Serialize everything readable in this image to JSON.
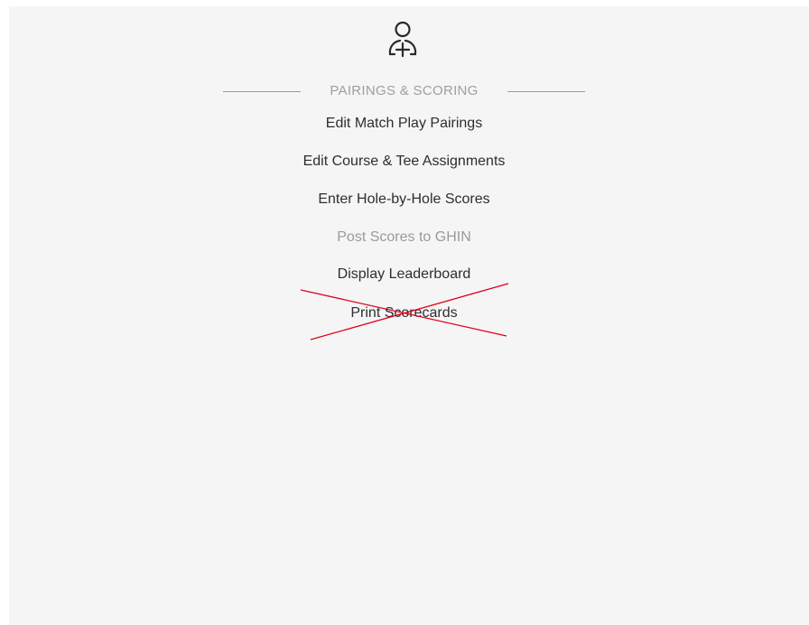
{
  "icon": "add-user-icon",
  "section": {
    "title": "PAIRINGS & SCORING"
  },
  "menu": {
    "items": [
      {
        "label": "Edit Match Play Pairings",
        "enabled": true
      },
      {
        "label": "Edit Course & Tee Assignments",
        "enabled": true
      },
      {
        "label": "Enter Hole-by-Hole Scores",
        "enabled": true
      },
      {
        "label": "Post Scores to GHIN",
        "enabled": false
      },
      {
        "label": "Display Leaderboard",
        "enabled": true
      },
      {
        "label": "Print Scorecards",
        "enabled": true,
        "crossed_out": true
      }
    ]
  },
  "colors": {
    "panel_background": "#f5f5f5",
    "text": "#2e2e2e",
    "disabled_text": "#9a9a9a",
    "cross_mark": "#e0001b"
  }
}
